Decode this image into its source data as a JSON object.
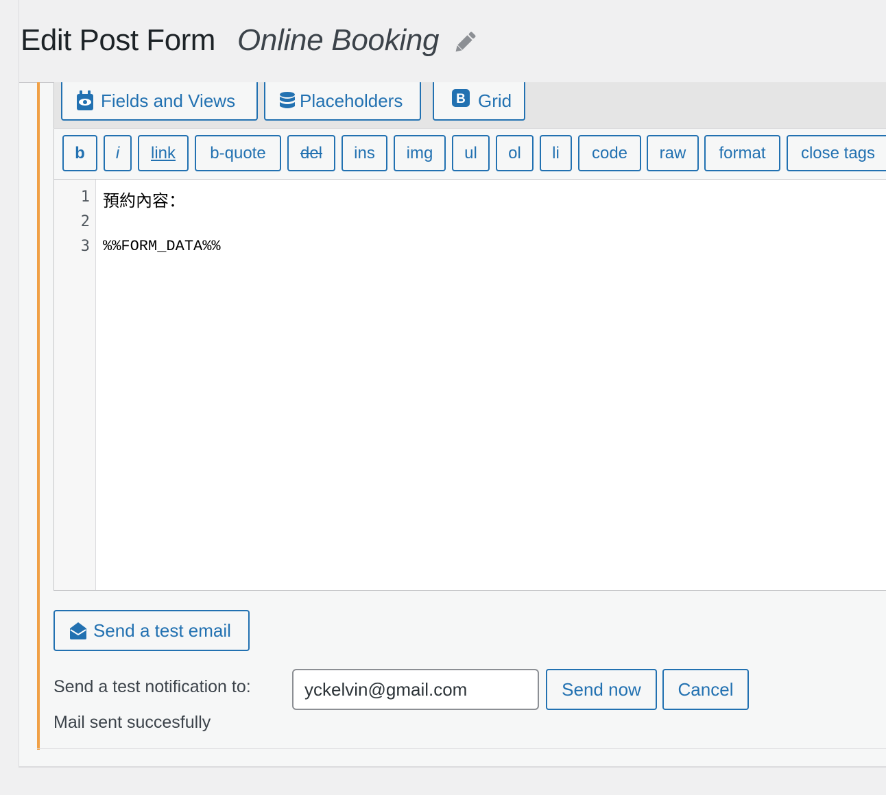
{
  "header": {
    "title": "Edit Post Form",
    "form_name": "Online Booking",
    "edit_icon": "pencil-icon"
  },
  "tabs": [
    {
      "label": "Fields and Views",
      "icon": "eye-calendar-icon"
    },
    {
      "label": "Placeholders",
      "icon": "database-icon"
    },
    {
      "label": "Grid",
      "icon": "bootstrap-b-icon"
    }
  ],
  "quicktags": [
    "b",
    "i",
    "link",
    "b-quote",
    "del",
    "ins",
    "img",
    "ul",
    "ol",
    "li",
    "code",
    "raw",
    "format",
    "close tags"
  ],
  "editor": {
    "line_numbers": [
      "1",
      "2",
      "3"
    ],
    "lines": [
      "預約內容：",
      "",
      "%%FORM_DATA%%"
    ]
  },
  "test_email": {
    "button_label": "Send a test email",
    "icon": "envelope-open-icon",
    "notify_label": "Send a test notification to:",
    "email_value": "yckelvin@gmail.com",
    "send_label": "Send now",
    "cancel_label": "Cancel",
    "status": "Mail sent succesfully"
  },
  "colors": {
    "accent": "#2271b1",
    "orange_bar": "#f0a046",
    "background": "#f0f0f1"
  }
}
